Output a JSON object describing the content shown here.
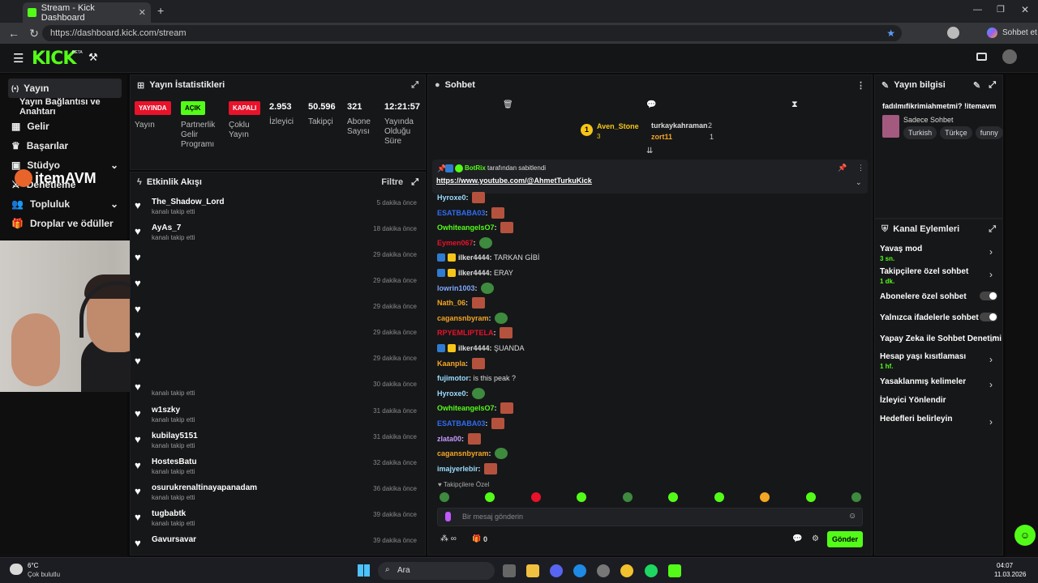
{
  "browser": {
    "tab_title": "Stream - Kick Dashboard",
    "url": "https://dashboard.kick.com/stream",
    "copilot": "Sohbet et"
  },
  "sidebar": {
    "items": [
      {
        "label": "Yayın"
      },
      {
        "label": "Yayın Bağlantısı ve Anahtarı"
      },
      {
        "label": "Gelir"
      },
      {
        "label": "Başarılar"
      },
      {
        "label": "Stüdyo"
      },
      {
        "label": "Denetleme"
      },
      {
        "label": "Topluluk"
      },
      {
        "label": "Droplar ve ödüller"
      }
    ]
  },
  "overlay": {
    "brand": "itemAVM"
  },
  "stats": {
    "title": "Yayın İstatistikleri",
    "badges": [
      {
        "text": "YAYINDA",
        "color": "#e8122b"
      },
      {
        "text": "AÇIK",
        "color": "#53fc18"
      },
      {
        "text": "KAPALI",
        "color": "#e8122b"
      }
    ],
    "badge_labels": [
      "Yayın",
      "Partnerlik Gelir Programı",
      "Çoklu Yayın"
    ],
    "values": [
      {
        "v": "2.953",
        "l": "İzleyici"
      },
      {
        "v": "50.596",
        "l": "Takipçi"
      },
      {
        "v": "321",
        "l": "Abone Sayısı"
      },
      {
        "v": "12:21:57",
        "l": "Yayında Olduğu Süre"
      }
    ]
  },
  "activity": {
    "title": "Etkinlik Akışı",
    "filter": "Filtre",
    "items": [
      {
        "name": "The_Shadow_Lord",
        "sub": "kanalı takip etti",
        "time": "5 dakika önce"
      },
      {
        "name": "AyAs_7",
        "sub": "kanalı takip etti",
        "time": "18 dakika önce"
      },
      {
        "name": "",
        "sub": "",
        "time": "29 dakika önce"
      },
      {
        "name": "",
        "sub": "",
        "time": "29 dakika önce"
      },
      {
        "name": "",
        "sub": "",
        "time": "29 dakika önce"
      },
      {
        "name": "",
        "sub": "",
        "time": "29 dakika önce"
      },
      {
        "name": "",
        "sub": "",
        "time": "29 dakika önce"
      },
      {
        "name": "",
        "sub": "kanalı takip etti",
        "time": "30 dakika önce"
      },
      {
        "name": "w1szky",
        "sub": "kanalı takip etti",
        "time": "31 dakika önce"
      },
      {
        "name": "kubilay5151",
        "sub": "kanalı takip etti",
        "time": "31 dakika önce"
      },
      {
        "name": "HostesBatu",
        "sub": "kanalı takip etti",
        "time": "32 dakika önce"
      },
      {
        "name": "osurukrenaltinayapanadam",
        "sub": "kanalı takip etti",
        "time": "36 dakika önce"
      },
      {
        "name": "tugbabtk",
        "sub": "kanalı takip etti",
        "time": "39 dakika önce"
      },
      {
        "name": "Gavursavar",
        "sub": "",
        "time": "39 dakika önce"
      }
    ]
  },
  "chat": {
    "title": "Sohbet",
    "leaders": {
      "first": "Aven_Stone",
      "first_count": "3",
      "others": [
        {
          "name": "turkaykahraman",
          "count": "2"
        },
        {
          "name": "zort11",
          "count": "1"
        }
      ]
    },
    "pinned": {
      "by": "BotRix",
      "suffix": "tarafından sabitlendi",
      "link": "https://www.youtube.com/@AhmetTurkuKick"
    },
    "messages": [
      {
        "user": "Hyroxe0",
        "color": "#9adcff",
        "text": "",
        "emo": "f"
      },
      {
        "user": "ESATBABA03",
        "color": "#2f6df3",
        "text": "",
        "emo": "f"
      },
      {
        "user": "OwhiteangelsO7",
        "color": "#53fc18",
        "text": "",
        "emo": "f"
      },
      {
        "user": "Eymen067",
        "color": "#e8122b",
        "text": "",
        "emo": "g"
      },
      {
        "user": "ilker4444",
        "color": "#ddd",
        "text": "TARKAN GİBİ",
        "emo": ""
      },
      {
        "user": "ilker4444",
        "color": "#ddd",
        "text": "ERAY",
        "emo": ""
      },
      {
        "user": "lowrin1003",
        "color": "#7fa8ff",
        "text": "",
        "emo": "g"
      },
      {
        "user": "Nath_06",
        "color": "#f5a623",
        "text": "",
        "emo": "f"
      },
      {
        "user": "cagansnbyram",
        "color": "#f5a623",
        "text": "",
        "emo": "g"
      },
      {
        "user": "RPYEMLIPTELA",
        "color": "#e8122b",
        "text": "",
        "emo": "f"
      },
      {
        "user": "ilker4444",
        "color": "#ddd",
        "text": "ŞUANDA",
        "emo": ""
      },
      {
        "user": "Kaanpla",
        "color": "#f5a623",
        "text": "",
        "emo": "f"
      },
      {
        "user": "fujimotor",
        "color": "#9adcff",
        "text": "is this peak ?",
        "emo": ""
      },
      {
        "user": "Hyroxe0",
        "color": "#9adcff",
        "text": "",
        "emo": "g"
      },
      {
        "user": "OwhiteangelsO7",
        "color": "#53fc18",
        "text": "",
        "emo": "f"
      },
      {
        "user": "ESATBABA03",
        "color": "#2f6df3",
        "text": "",
        "emo": "f"
      },
      {
        "user": "zlata00",
        "color": "#c59aff",
        "text": "",
        "emo": "f"
      },
      {
        "user": "cagansnbyram",
        "color": "#f5a623",
        "text": "",
        "emo": "g"
      },
      {
        "user": "imajyerlebir",
        "color": "#9adcff",
        "text": "",
        "emo": "f"
      }
    ],
    "followers_only": "Takipçilere Özel",
    "placeholder": "Bir mesaj gönderin",
    "send": "Gönder",
    "count": "0"
  },
  "info": {
    "title": "Yayın bilgisi",
    "stream_title": "fadılmıfikrimiahmetmi? !itemavm",
    "category": "Sadece Sohbet",
    "tags": [
      "Turkish",
      "Türkçe",
      "funny"
    ]
  },
  "channel_actions": {
    "title": "Kanal Eylemleri",
    "items": [
      {
        "label": "Yavaş mod",
        "sub": "3 sn.",
        "ctrl": "chev"
      },
      {
        "label": "Takipçilere özel sohbet",
        "sub": "1 dk.",
        "ctrl": "chev"
      },
      {
        "label": "Abonelere özel sohbet",
        "sub": "",
        "ctrl": "toggle"
      },
      {
        "label": "Yalnızca ifadelerle sohbet",
        "sub": "",
        "ctrl": "toggle"
      },
      {
        "label": "Yapay Zeka ile Sohbet Denetimi",
        "sub": "",
        "ctrl": "ext"
      },
      {
        "label": "Hesap yaşı kısıtlaması",
        "sub": "1 hf.",
        "ctrl": "chev"
      },
      {
        "label": "Yasaklanmış kelimeler",
        "sub": "",
        "ctrl": "chev"
      },
      {
        "label": "İzleyici Yönlendir",
        "sub": "",
        "ctrl": ""
      },
      {
        "label": "Hedefleri belirleyin",
        "sub": "",
        "ctrl": "chev"
      }
    ]
  },
  "taskbar": {
    "weather_temp": "6°C",
    "weather_desc": "Çok bulutlu",
    "search": "Ara",
    "time": "04:07",
    "date": "11.03.2026"
  }
}
